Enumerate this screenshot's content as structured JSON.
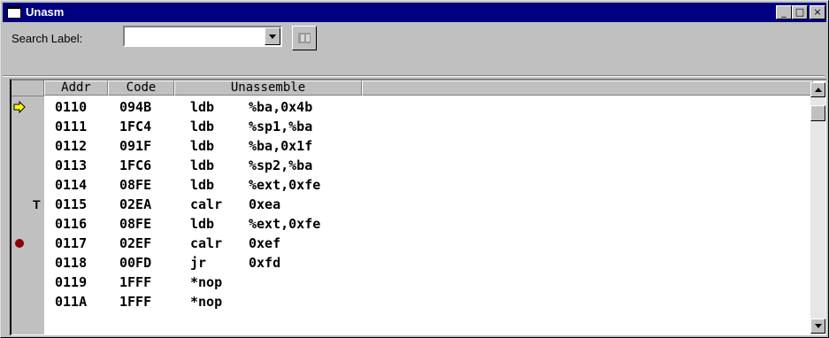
{
  "window": {
    "title": "Unasm",
    "buttons": {
      "minimize": "_",
      "maximize": "□",
      "close": "×"
    }
  },
  "toolbar": {
    "search_label": "Search Label:",
    "search_value": "",
    "find_icon": "find-icon"
  },
  "columns": {
    "addr": "Addr",
    "code": "Code",
    "unassemble": "Unassemble"
  },
  "rows": [
    {
      "marker": "current-pc-arrow",
      "mark": "",
      "addr": "0110",
      "code": "094B",
      "mnemonic": "ldb",
      "operands": "%ba,0x4b"
    },
    {
      "marker": "",
      "mark": "",
      "addr": "0111",
      "code": "1FC4",
      "mnemonic": "ldb",
      "operands": "%sp1,%ba"
    },
    {
      "marker": "",
      "mark": "",
      "addr": "0112",
      "code": "091F",
      "mnemonic": "ldb",
      "operands": "%ba,0x1f"
    },
    {
      "marker": "",
      "mark": "",
      "addr": "0113",
      "code": "1FC6",
      "mnemonic": "ldb",
      "operands": "%sp2,%ba"
    },
    {
      "marker": "",
      "mark": "",
      "addr": "0114",
      "code": "08FE",
      "mnemonic": "ldb",
      "operands": "%ext,0xfe"
    },
    {
      "marker": "",
      "mark": "T",
      "addr": "0115",
      "code": "02EA",
      "mnemonic": "calr",
      "operands": "0xea"
    },
    {
      "marker": "",
      "mark": "",
      "addr": "0116",
      "code": "08FE",
      "mnemonic": "ldb",
      "operands": "%ext,0xfe"
    },
    {
      "marker": "breakpoint-dot",
      "mark": "",
      "addr": "0117",
      "code": "02EF",
      "mnemonic": "calr",
      "operands": "0xef"
    },
    {
      "marker": "",
      "mark": "",
      "addr": "0118",
      "code": "00FD",
      "mnemonic": "jr",
      "operands": "0xfd"
    },
    {
      "marker": "",
      "mark": "",
      "addr": "0119",
      "code": "1FFF",
      "mnemonic": "*nop",
      "operands": ""
    },
    {
      "marker": "",
      "mark": "",
      "addr": "011A",
      "code": "1FFF",
      "mnemonic": "*nop",
      "operands": ""
    }
  ],
  "colors": {
    "title_bar": "#000080",
    "arrow": "#ffff00",
    "breakpoint": "#8b0000",
    "window_face": "#c0c0c0"
  }
}
